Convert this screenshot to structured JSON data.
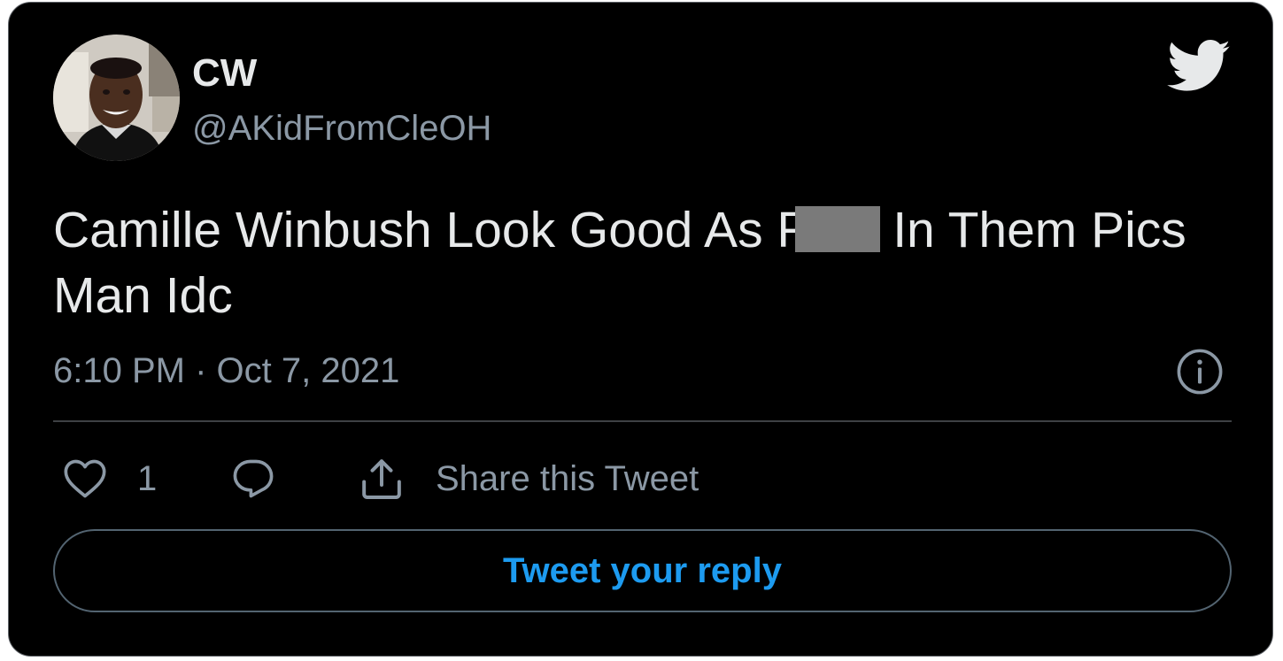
{
  "user": {
    "display_name": "CW",
    "handle": "@AKidFromCleOH"
  },
  "tweet": {
    "text_before": "Camille Winbush Look Good As F",
    "text_after": "In Them Pics Man Idc",
    "timestamp": "6:10 PM · Oct 7, 2021"
  },
  "actions": {
    "like_count": "1",
    "share_label": "Share this Tweet"
  },
  "reply": {
    "button_label": "Tweet your reply"
  },
  "icons": {
    "brand": "twitter-bird-icon",
    "info": "info-icon",
    "like": "heart-icon",
    "reply": "reply-icon",
    "share": "share-icon"
  },
  "colors": {
    "background": "#000000",
    "text": "#e7e9ea",
    "muted": "#8b98a5",
    "accent": "#1d9bf0",
    "censor": "#7a7a7a"
  }
}
